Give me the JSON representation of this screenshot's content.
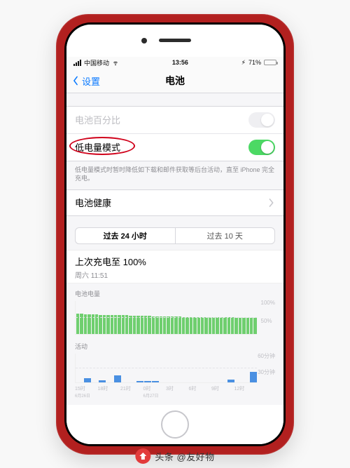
{
  "status": {
    "carrier": "中国移动",
    "time": "13:56",
    "battery_pct": "71%",
    "battery_fill_pct": 71
  },
  "nav": {
    "back_label": "设置",
    "title": "电池"
  },
  "rows": {
    "battery_percent_label": "电池百分比",
    "low_power_label": "低电量模式",
    "low_power_note": "低电量模式时暂时降低如下载和邮件获取等后台活动，直至 iPhone 完全充电。",
    "battery_health_label": "电池健康"
  },
  "segmented": {
    "tab24": "过去 24 小时",
    "tab10": "过去 10 天"
  },
  "charge": {
    "headline": "上次充电至 100%",
    "sub": "周六 11:51"
  },
  "charts": {
    "level_title": "电池电量",
    "activity_title": "活动"
  },
  "chart_data": [
    {
      "type": "bar",
      "title": "电池电量",
      "ylabel": "%",
      "ylim": [
        0,
        100
      ],
      "ytick_labels": [
        "100%",
        "50%"
      ],
      "categories": [
        "15时",
        "18时",
        "21时",
        "0时",
        "3时",
        "6时",
        "9时",
        "12时"
      ],
      "x_day_labels": [
        "6月26日",
        "",
        "",
        "6月27日",
        "",
        "",
        "",
        ""
      ],
      "values": [
        62,
        61,
        60,
        60,
        59,
        59,
        58,
        58,
        57,
        57,
        57,
        56,
        56,
        56,
        55,
        55,
        55,
        54,
        54,
        54,
        53,
        53,
        53,
        52,
        52,
        52,
        52,
        52,
        51,
        51,
        51,
        51,
        51,
        51,
        50,
        50,
        50,
        50,
        50,
        50,
        50,
        50,
        49,
        49,
        49,
        49,
        49,
        49
      ]
    },
    {
      "type": "bar",
      "title": "活动",
      "ylabel": "分钟",
      "ylim": [
        0,
        60
      ],
      "ytick_labels": [
        "60分钟",
        "30分钟"
      ],
      "categories": [
        "15时",
        "18时",
        "21时",
        "0时",
        "3时",
        "6时",
        "9时",
        "12时"
      ],
      "values": [
        0,
        8,
        0,
        4,
        0,
        14,
        0,
        0,
        3,
        3,
        3,
        0,
        0,
        0,
        0,
        0,
        0,
        0,
        0,
        0,
        6,
        0,
        0,
        22
      ]
    }
  ],
  "watermark": {
    "text": "头条 @友好物"
  }
}
